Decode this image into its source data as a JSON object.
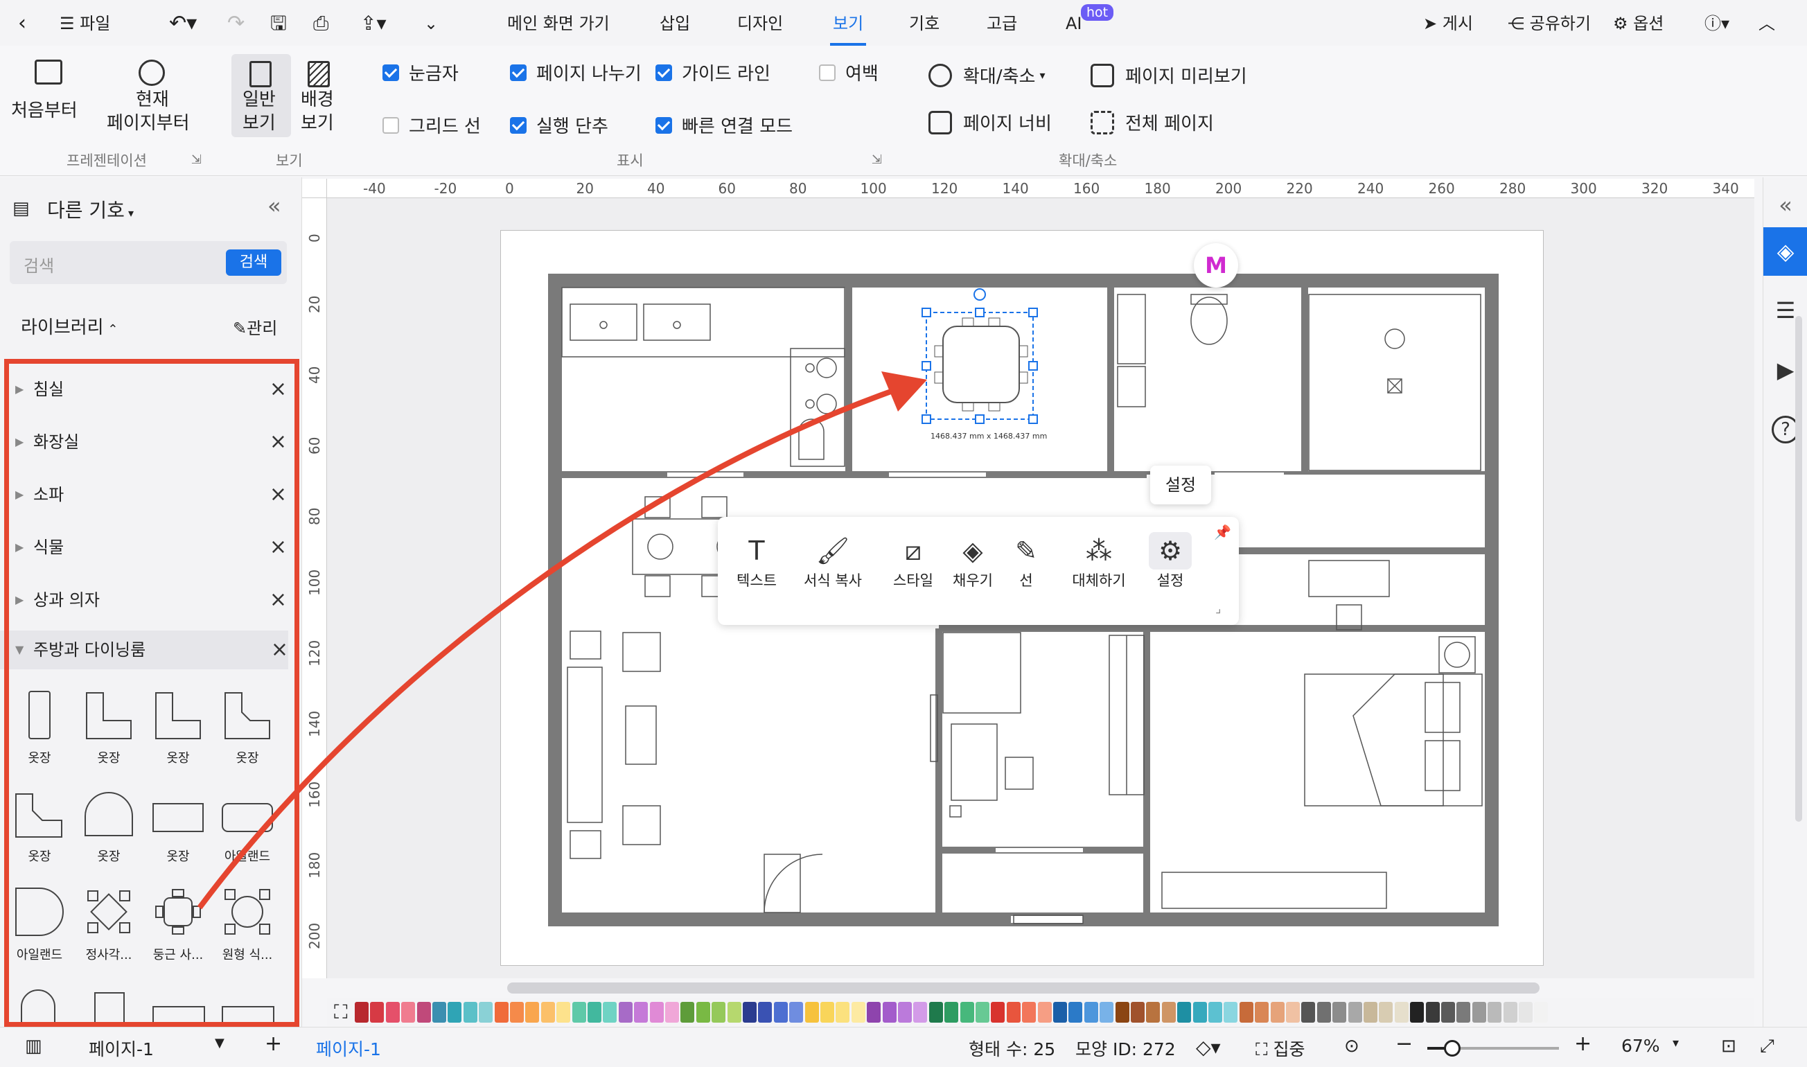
{
  "topbar": {
    "file": "파일",
    "tabs": [
      "메인 화면 가기",
      "삽입",
      "디자인",
      "보기",
      "기호",
      "고급",
      "AI"
    ],
    "active_tab": "보기",
    "ai_badge": "hot",
    "publish": "게시",
    "share": "공유하기",
    "options": "옵션"
  },
  "ribbon": {
    "from_start": "처음부터",
    "from_current_1": "현재",
    "from_current_2": "페이지부터",
    "group_presentation": "프레젠테이션",
    "normal_view_1": "일반",
    "normal_view_2": "보기",
    "background_view_1": "배경",
    "background_view_2": "보기",
    "group_view": "보기",
    "checks": {
      "ruler": "눈금자",
      "page_break": "페이지 나누기",
      "guide": "가이드 라인",
      "margin": "여백",
      "grid": "그리드 선",
      "undo_step": "실행 단추",
      "quick_connect": "빠른 연결 모드"
    },
    "group_display": "표시",
    "zoom": "확대/축소",
    "page_preview": "페이지 미리보기",
    "page_width": "페이지 너비",
    "full_page": "전체 페이지",
    "group_zoom": "확대/축소"
  },
  "left": {
    "title": "다른 기호",
    "search_placeholder": "검색",
    "search_button": "검색",
    "library": "라이브러리",
    "manage": "관리",
    "categories": [
      "침실",
      "화장실",
      "소파",
      "식물",
      "상과 의자",
      "주방과 다이닝룸"
    ],
    "shapes": [
      "옷장",
      "옷장",
      "옷장",
      "옷장",
      "옷장",
      "옷장",
      "옷장",
      "아일랜드",
      "아일랜드",
      "정사각...",
      "둥근 사...",
      "원형 식..."
    ]
  },
  "ruler": {
    "top": [
      "-40",
      "-20",
      "0",
      "20",
      "40",
      "60",
      "80",
      "100",
      "120",
      "140",
      "160",
      "180",
      "200",
      "220",
      "240",
      "260",
      "280",
      "300",
      "320",
      "340"
    ],
    "left": [
      "0",
      "20",
      "40",
      "60",
      "80",
      "100",
      "120",
      "140",
      "160",
      "180",
      "200"
    ]
  },
  "selection_size": "1468.437 mm x 1468.437 mm",
  "floatbar": {
    "items": [
      "텍스트",
      "서식 복사",
      "스타일",
      "채우기",
      "선",
      "대체하기",
      "설정"
    ]
  },
  "tooltip": "설정",
  "statusbar": {
    "page_select": "페이지-1",
    "page_tab": "페이지-1",
    "shape_count": "형태 수: 25",
    "shape_id": "모양 ID: 272",
    "focus": "집중",
    "zoom": "67%"
  },
  "colors": {
    "accent": "#1a73e8",
    "annotation": "#e5452f",
    "wall": "#7a7a7a"
  }
}
